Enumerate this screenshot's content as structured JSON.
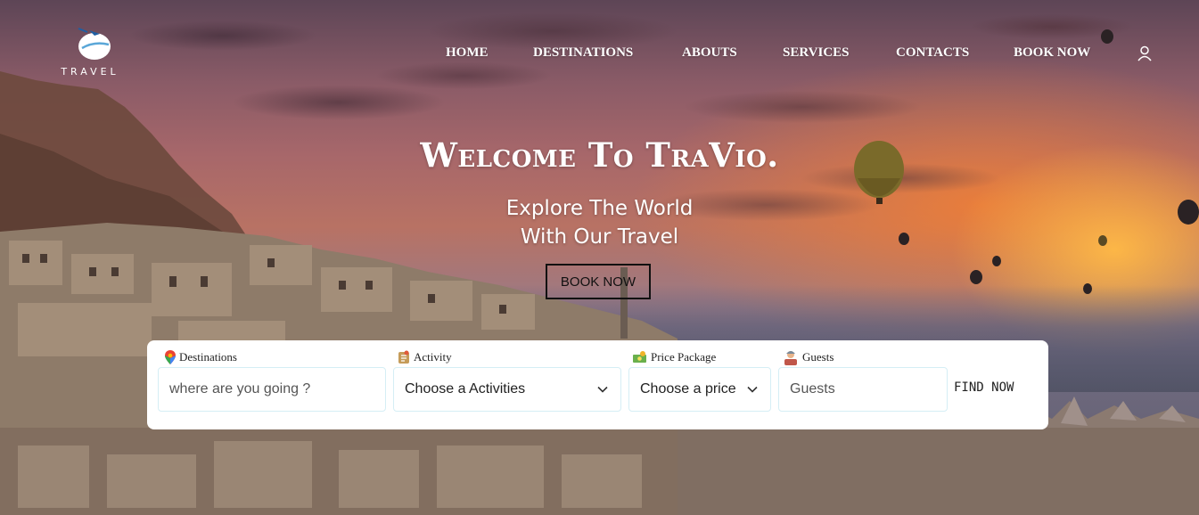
{
  "brand": {
    "logo_text": "TRAVEL"
  },
  "nav": {
    "items": [
      {
        "label": "HOME"
      },
      {
        "label": "DESTINATIONS"
      },
      {
        "label": "ABOUTS"
      },
      {
        "label": "SERVICES"
      },
      {
        "label": "CONTACTS"
      },
      {
        "label": "BOOK NOW"
      }
    ],
    "user_icon": "user-icon"
  },
  "hero": {
    "title": "Welcome To TraVio.",
    "subtitle_line1": "Explore The World",
    "subtitle_line2": "With Our Travel",
    "cta_label": "BOOK NOW"
  },
  "search": {
    "destinations": {
      "label": "Destinations",
      "icon": "map-pin-icon",
      "placeholder": "where are you going ?"
    },
    "activity": {
      "label": "Activity",
      "icon": "activity-icon",
      "value": "Choose a Activities"
    },
    "price": {
      "label": "Price Package",
      "icon": "money-icon",
      "value": "Choose a price"
    },
    "guests": {
      "label": "Guests",
      "icon": "guest-icon",
      "placeholder": "Guests"
    },
    "find_label": "FIND NOW"
  },
  "colors": {
    "nav_text": "#ffffff",
    "panel_bg": "#ffffff",
    "field_border": "#d5eef5"
  }
}
